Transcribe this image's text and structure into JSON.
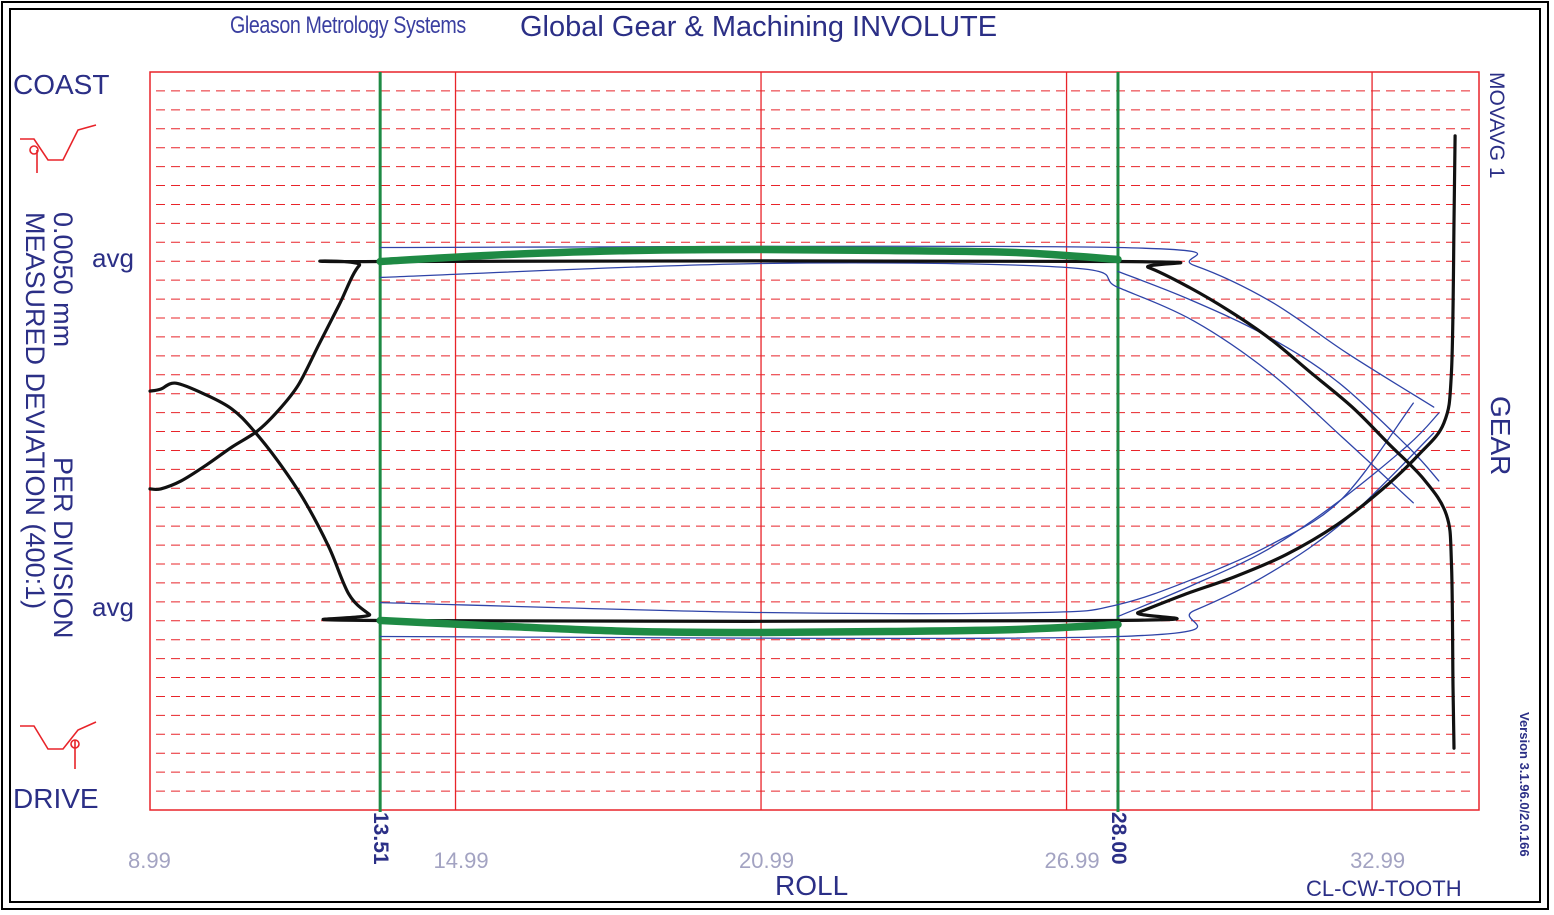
{
  "header": {
    "brand": "Gleason Metrology Systems",
    "title": "Global Gear & Machining  INVOLUTE"
  },
  "left_panel": {
    "coast": "COAST",
    "drive": "DRIVE",
    "avg_top": "avg",
    "avg_bottom": "avg",
    "scale_value": "0.0050 mm",
    "per_division": "PER DIVISION",
    "measured_deviation": "MEASURED DEVIATION (400:1)"
  },
  "right_panel": {
    "movavg": "MOVAVG 1",
    "side": "GEAR",
    "version": "Version 3.1.96.0/2.0.166"
  },
  "footer": {
    "axis_label": "ROLL",
    "tooth": "CL-CW-TOOTH"
  },
  "colors": {
    "grid_red": "#e8242a",
    "measured_black": "#111111",
    "average_green": "#1e8a44",
    "tolerance_blue": "#2f44a8",
    "text_navy": "#2b2f86",
    "tick_gray": "#a3a3c2"
  },
  "chart_data": {
    "type": "line",
    "xlabel": "ROLL",
    "xlim": [
      8.99,
      35.09
    ],
    "x_ticks": [
      "8.99",
      "14.99",
      "20.99",
      "26.99",
      "32.99"
    ],
    "evaluation_markers": [
      "13.51",
      "28.00"
    ],
    "evaluation_range": [
      13.51,
      28.0
    ],
    "ylim_divisions": [
      -18.5,
      18.5
    ],
    "avg_levels_divisions": [
      9,
      -9
    ],
    "series": [
      {
        "role": "measured-coast",
        "style": "black",
        "points": [
          [
            8.99,
            -2.4
          ],
          [
            9.2,
            -2.4
          ],
          [
            9.6,
            -2.0
          ],
          [
            10.1,
            -1.2
          ],
          [
            10.6,
            -0.3
          ],
          [
            11.1,
            0.5
          ],
          [
            11.5,
            1.5
          ],
          [
            11.9,
            2.8
          ],
          [
            12.3,
            4.8
          ],
          [
            12.7,
            6.8
          ],
          [
            13.1,
            8.8
          ],
          [
            13.51,
            9.0
          ],
          [
            28.0,
            9.0
          ],
          [
            28.6,
            8.7
          ],
          [
            29.4,
            7.7
          ],
          [
            30.2,
            6.5
          ],
          [
            31.0,
            5.1
          ],
          [
            31.8,
            3.4
          ],
          [
            32.6,
            1.7
          ],
          [
            33.3,
            -0.1
          ],
          [
            34.0,
            -1.9
          ],
          [
            34.45,
            -3.7
          ],
          [
            34.55,
            -6.2
          ],
          [
            34.58,
            -12.3
          ],
          [
            34.6,
            -15.4
          ]
        ]
      },
      {
        "role": "measured-drive",
        "style": "black",
        "points": [
          [
            8.99,
            2.5
          ],
          [
            9.2,
            2.6
          ],
          [
            9.5,
            2.9
          ],
          [
            10.1,
            2.3
          ],
          [
            10.6,
            1.6
          ],
          [
            11.0,
            0.6
          ],
          [
            11.5,
            -1.0
          ],
          [
            12.0,
            -2.9
          ],
          [
            12.5,
            -5.3
          ],
          [
            12.9,
            -7.7
          ],
          [
            13.3,
            -8.7
          ],
          [
            13.51,
            -9.0
          ],
          [
            28.0,
            -9.0
          ],
          [
            28.4,
            -8.6
          ],
          [
            29.3,
            -7.7
          ],
          [
            30.3,
            -6.8
          ],
          [
            31.3,
            -5.7
          ],
          [
            32.3,
            -4.2
          ],
          [
            33.2,
            -2.4
          ],
          [
            33.9,
            -0.7
          ],
          [
            34.4,
            0.9
          ],
          [
            34.55,
            3.5
          ],
          [
            34.6,
            11.0
          ],
          [
            34.62,
            15.3
          ]
        ]
      },
      {
        "role": "average-coast",
        "style": "green-thick",
        "points": [
          [
            13.51,
            9.0
          ],
          [
            16.0,
            9.35
          ],
          [
            18.5,
            9.55
          ],
          [
            21.0,
            9.6
          ],
          [
            23.5,
            9.55
          ],
          [
            26.0,
            9.45
          ],
          [
            28.0,
            9.1
          ]
        ]
      },
      {
        "role": "average-drive",
        "style": "green-thick",
        "points": [
          [
            13.51,
            -9.0
          ],
          [
            16.0,
            -9.3
          ],
          [
            18.5,
            -9.55
          ],
          [
            21.0,
            -9.6
          ],
          [
            23.5,
            -9.55
          ],
          [
            26.0,
            -9.45
          ],
          [
            28.0,
            -9.2
          ]
        ]
      },
      {
        "role": "tolerance-coast-upper",
        "style": "blue-thin",
        "points": [
          [
            13.51,
            9.7
          ],
          [
            28.0,
            9.7
          ],
          [
            29.5,
            8.8
          ],
          [
            31.0,
            7.0
          ],
          [
            32.5,
            4.4
          ],
          [
            34.2,
            1.7
          ]
        ]
      },
      {
        "role": "tolerance-coast-lower",
        "style": "blue-thin",
        "points": [
          [
            13.51,
            8.2
          ],
          [
            21.0,
            8.9
          ],
          [
            27.0,
            8.7
          ],
          [
            28.0,
            7.7
          ],
          [
            29.5,
            6.0
          ],
          [
            31.0,
            3.4
          ],
          [
            32.4,
            0.2
          ],
          [
            33.8,
            -3.1
          ]
        ]
      },
      {
        "role": "tolerance-coast-inner",
        "style": "blue-thin",
        "points": [
          [
            28.0,
            8.5
          ],
          [
            29.4,
            7.1
          ],
          [
            30.9,
            5.3
          ],
          [
            32.3,
            3.0
          ],
          [
            33.7,
            -0.3
          ],
          [
            34.3,
            -2.0
          ]
        ]
      },
      {
        "role": "tolerance-drive-upper",
        "style": "blue-thin",
        "points": [
          [
            13.51,
            -8.1
          ],
          [
            21.0,
            -8.6
          ],
          [
            26.5,
            -8.6
          ],
          [
            28.0,
            -8.2
          ],
          [
            29.5,
            -6.9
          ],
          [
            31.0,
            -5.2
          ],
          [
            32.4,
            -2.9
          ],
          [
            33.8,
            1.9
          ]
        ]
      },
      {
        "role": "tolerance-drive-lower",
        "style": "blue-thin",
        "points": [
          [
            13.51,
            -9.8
          ],
          [
            28.0,
            -9.8
          ],
          [
            29.5,
            -8.5
          ],
          [
            31.0,
            -6.6
          ],
          [
            32.5,
            -3.9
          ],
          [
            34.2,
            0.4
          ]
        ]
      },
      {
        "role": "tolerance-drive-inner",
        "style": "blue-thin",
        "points": [
          [
            28.0,
            -8.8
          ],
          [
            29.4,
            -7.3
          ],
          [
            30.9,
            -5.5
          ],
          [
            32.3,
            -3.1
          ],
          [
            33.7,
            -0.2
          ],
          [
            34.3,
            1.4
          ]
        ]
      }
    ]
  }
}
